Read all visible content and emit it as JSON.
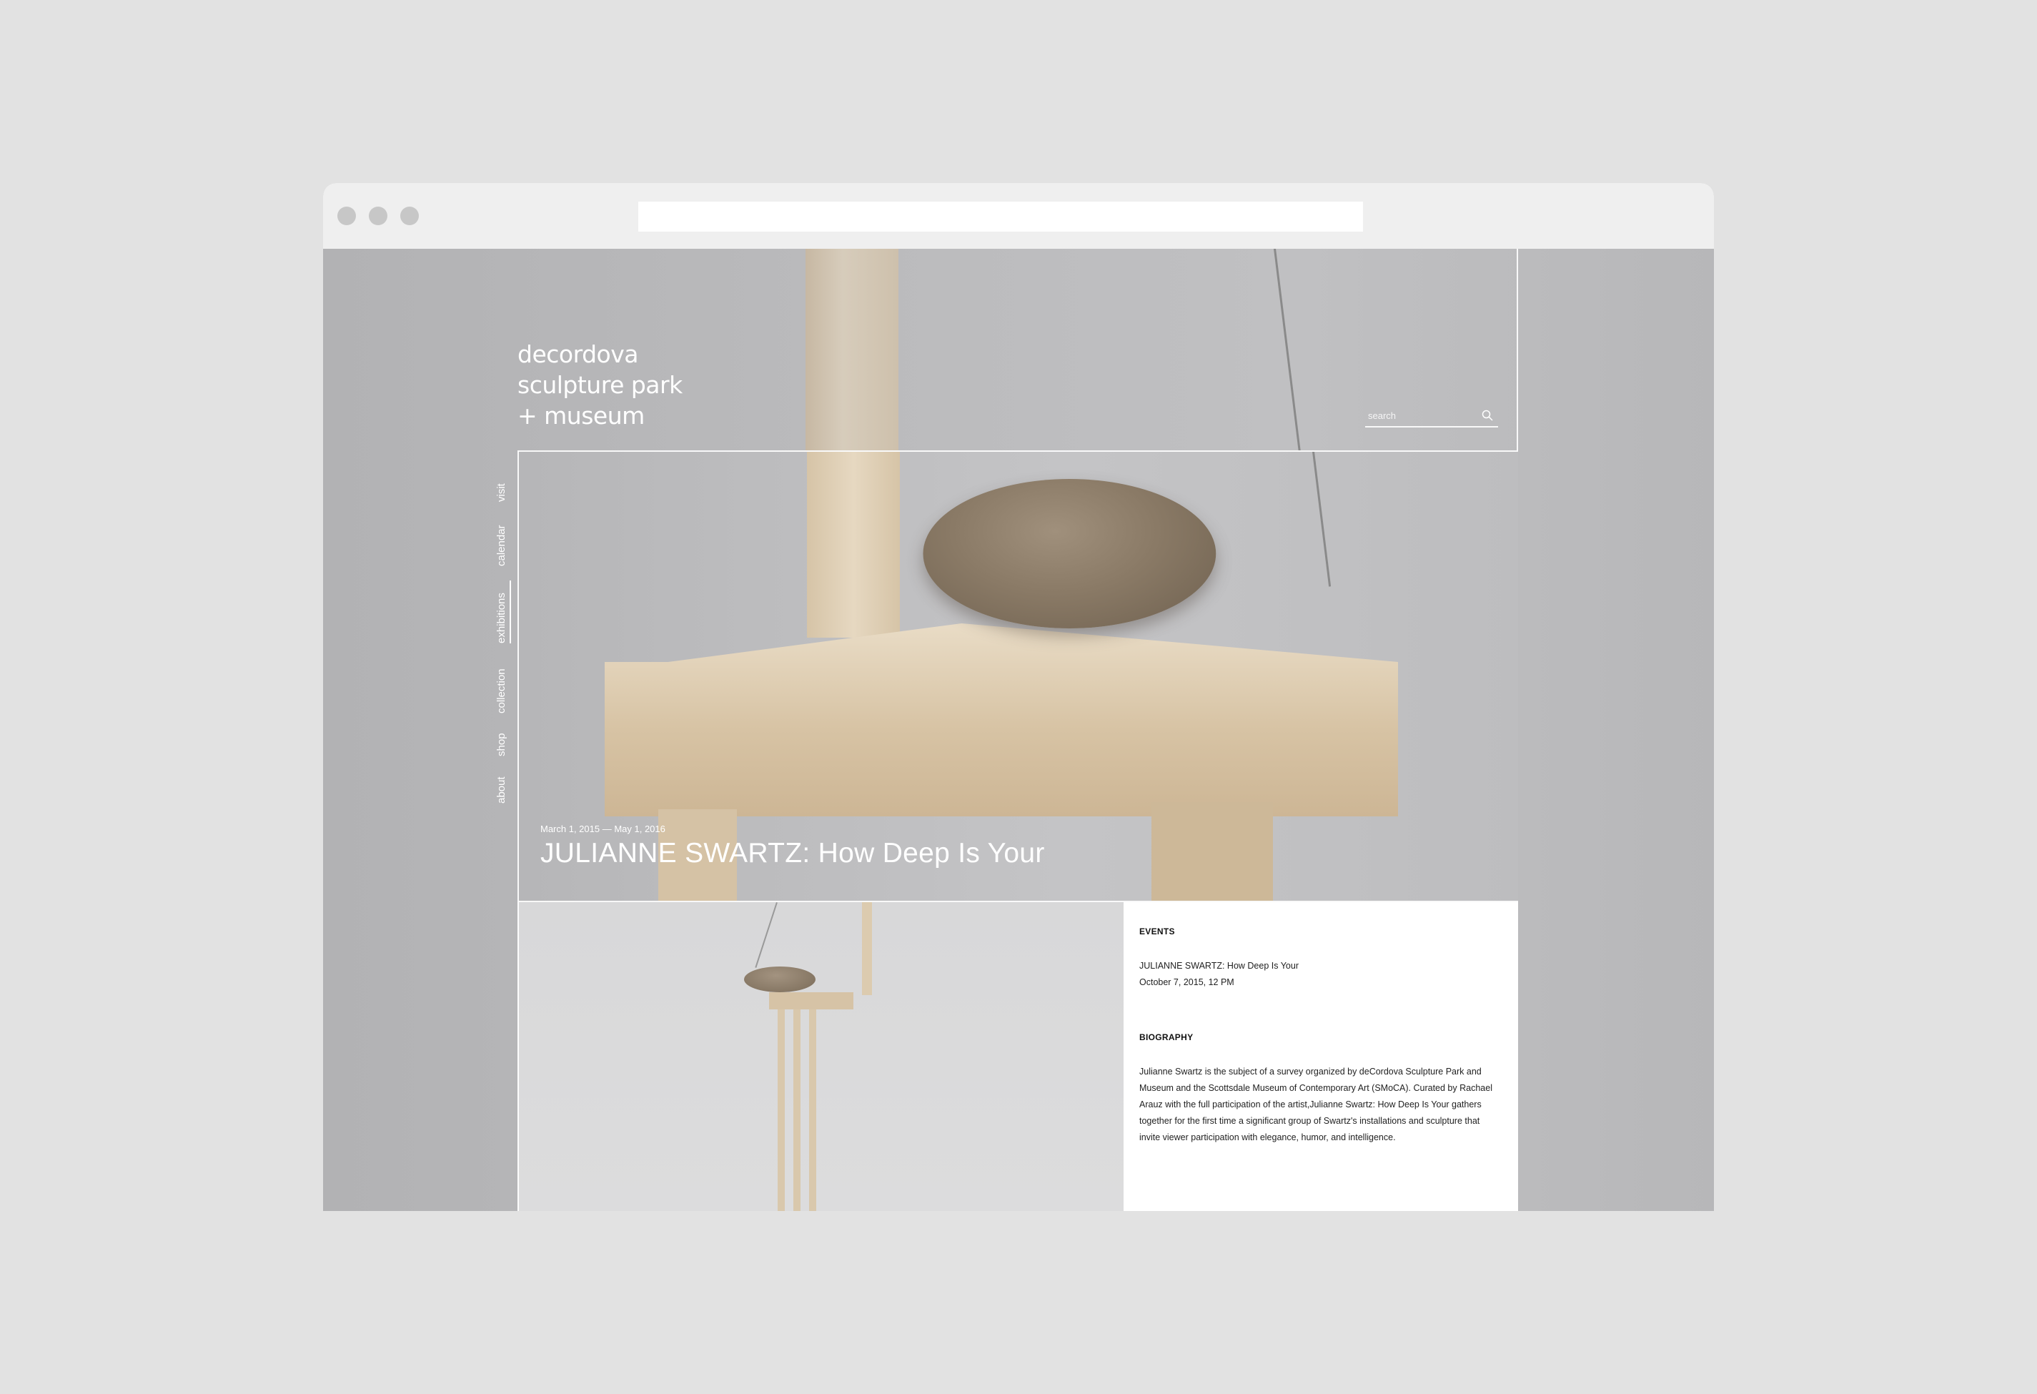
{
  "site": {
    "logo_lines": [
      "decordova",
      "sculpture park",
      "+ museum"
    ],
    "search_placeholder": "search"
  },
  "nav": {
    "items": [
      {
        "label": "visit"
      },
      {
        "label": "calendar"
      },
      {
        "label": "exhibitions",
        "active": true
      },
      {
        "label": "collection"
      },
      {
        "label": "shop"
      },
      {
        "label": "about"
      }
    ]
  },
  "hero": {
    "dates": "March 1, 2015 — May 1, 2016",
    "title": "JULIANNE SWARTZ: How Deep Is Your"
  },
  "events": {
    "heading": "EVENTS",
    "item_title": "JULIANNE SWARTZ: How Deep Is Your",
    "item_date": "October 7, 2015, 12 PM"
  },
  "biography": {
    "heading": "BIOGRAPHY",
    "text": "Julianne Swartz is the subject of a survey organized by deCordova Sculpture Park and Museum and the Scottsdale Museum of Contemporary Art (SMoCA). Curated by Rachael Arauz with the full participation of the artist,Julianne Swartz: How Deep Is Your gathers together for the first time a significant group of Swartz's installations and sculpture that invite viewer participation with elegance, humor, and intelligence."
  },
  "icons": {
    "search": "search-icon"
  },
  "colors": {
    "page_bg": "#e2e2e2",
    "chrome_bg": "#efefef",
    "window_dots": "#c7c7c7",
    "site_bg": "#b4b4b6",
    "text_light": "#ffffff",
    "panel_bg": "#ffffff"
  }
}
